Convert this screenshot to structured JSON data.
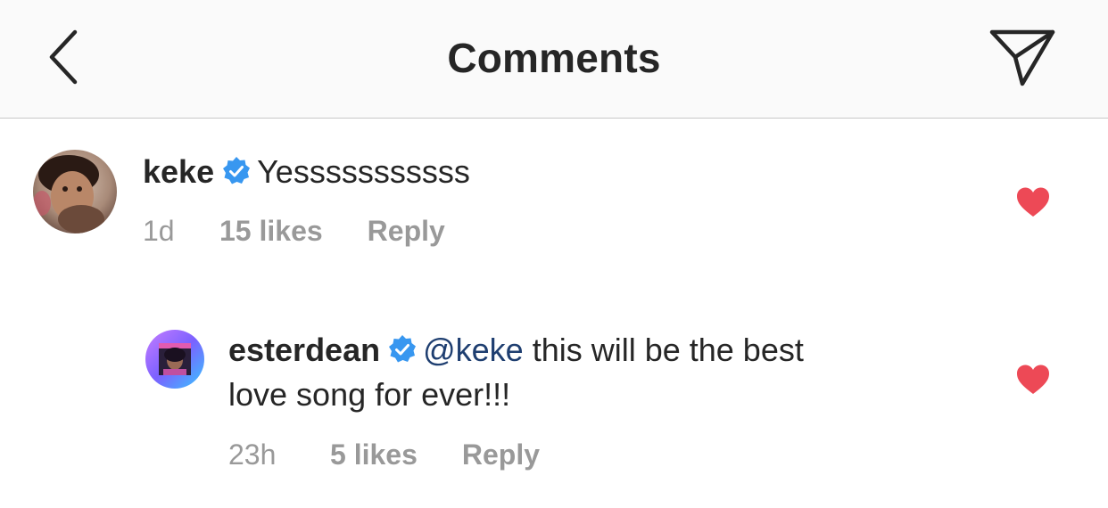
{
  "header": {
    "title": "Comments",
    "back_icon": "chevron-left-icon",
    "share_icon": "paper-plane-icon"
  },
  "colors": {
    "header_bg": "#fafafa",
    "text": "#262626",
    "meta_text": "#999999",
    "mention": "#1e3e70",
    "verified": "#3897f0",
    "heart": "#ed4956"
  },
  "comments": [
    {
      "username": "keke",
      "verified": true,
      "text": "Yesssssssssss",
      "time": "1d",
      "likes": "15 likes",
      "reply": "Reply",
      "liked": true
    },
    {
      "username": "esterdean",
      "verified": true,
      "mention": "@keke",
      "text_line1": " this will be the best",
      "text_line2": "love song for ever!!!",
      "time": "23h",
      "likes": "5 likes",
      "reply": "Reply",
      "liked": true
    }
  ]
}
